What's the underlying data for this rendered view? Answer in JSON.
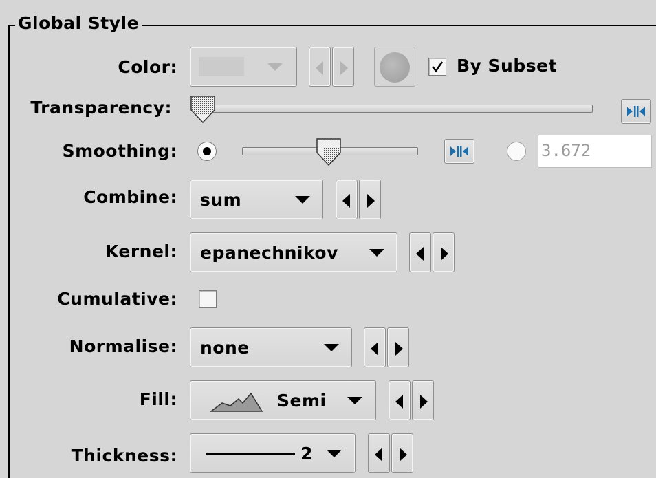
{
  "panel": {
    "title": "Global Style"
  },
  "color": {
    "label": "Color:",
    "by_subset_label": "By Subset",
    "by_subset_checked": true,
    "enabled": false
  },
  "transparency": {
    "label": "Transparency:",
    "level": 0.0
  },
  "smoothing": {
    "label": "Smoothing:",
    "level": 0.5,
    "value_text": "3.672",
    "slider_selected": true
  },
  "combine": {
    "label": "Combine:",
    "value": "sum"
  },
  "kernel": {
    "label": "Kernel:",
    "value": "epanechnikov"
  },
  "cumulative": {
    "label": "Cumulative:",
    "checked": false
  },
  "normalise": {
    "label": "Normalise:",
    "value": "none"
  },
  "fill": {
    "label": "Fill:",
    "value": "Semi"
  },
  "thickness": {
    "label": "Thickness:",
    "value": "2"
  },
  "colors": {
    "background": "#d6d6d6",
    "reset_icon": "#1c6fae",
    "disabled": "#b4b4b4"
  },
  "icons": {
    "reset": "reset-arrows-icon",
    "prev": "triangle-left-icon",
    "next": "triangle-right-icon",
    "dropdown": "triangle-down-icon",
    "marker": "filled-circle-icon",
    "fill_preview": "mountain-outline-icon",
    "line_preview": "horizontal-line-icon"
  }
}
